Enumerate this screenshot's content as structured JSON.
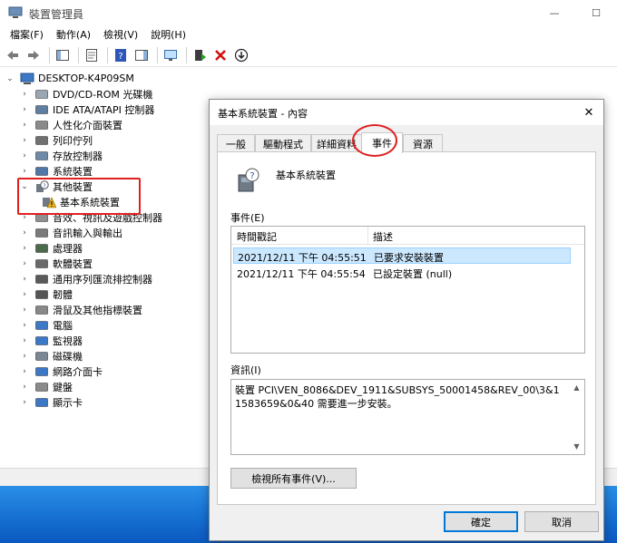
{
  "window": {
    "title": "裝置管理員",
    "minimize_glyph": "—",
    "maximize_glyph": "☐",
    "close_glyph": "✕"
  },
  "menu": [
    "檔案(F)",
    "動作(A)",
    "檢視(V)",
    "說明(H)"
  ],
  "toolbar": {
    "buttons": [
      "back-icon",
      "forward-icon",
      "show-hide-console-tree-icon",
      "properties-icon",
      "help-icon",
      "action-pane-icon",
      "scan-monitor-icon",
      "update-driver-icon",
      "uninstall-icon",
      "disable-icon"
    ]
  },
  "tree": {
    "root": "DESKTOP-K4P09SM",
    "items": [
      {
        "label": "DVD/CD-ROM 光碟機",
        "icon": "dvd-icon"
      },
      {
        "label": "IDE ATA/ATAPI 控制器",
        "icon": "ide-controller-icon"
      },
      {
        "label": "人性化介面裝置",
        "icon": "hid-icon"
      },
      {
        "label": "列印佇列",
        "icon": "printer-icon"
      },
      {
        "label": "存放控制器",
        "icon": "storage-controller-icon"
      },
      {
        "label": "系統裝置",
        "icon": "system-device-icon"
      },
      {
        "label": "其他裝置",
        "icon": "unknown-device-icon",
        "expanded": true
      },
      {
        "label": "基本系統裝置",
        "icon": "warning-device-icon",
        "child": true
      },
      {
        "label": "音效、視訊及遊戲控制器",
        "icon": "audio-icon"
      },
      {
        "label": "音訊輸入與輸出",
        "icon": "audio-io-icon"
      },
      {
        "label": "處理器",
        "icon": "processor-icon"
      },
      {
        "label": "軟體裝置",
        "icon": "software-device-icon"
      },
      {
        "label": "通用序列匯流排控制器",
        "icon": "usb-icon"
      },
      {
        "label": "韌體",
        "icon": "firmware-icon"
      },
      {
        "label": "滑鼠及其他指標裝置",
        "icon": "mouse-icon"
      },
      {
        "label": "電腦",
        "icon": "computer-icon"
      },
      {
        "label": "監視器",
        "icon": "monitor-icon"
      },
      {
        "label": "磁碟機",
        "icon": "disk-drive-icon"
      },
      {
        "label": "網路介面卡",
        "icon": "network-adapter-icon"
      },
      {
        "label": "鍵盤",
        "icon": "keyboard-icon"
      },
      {
        "label": "顯示卡",
        "icon": "display-adapter-icon"
      }
    ]
  },
  "dialog": {
    "title": "基本系統裝置 - 內容",
    "close_glyph": "✕",
    "tabs": [
      "一般",
      "驅動程式",
      "詳細資料",
      "事件",
      "資源"
    ],
    "active_tab": "事件",
    "device_name": "基本系統裝置",
    "events_label": "事件(E)",
    "columns": [
      "時間戳記",
      "描述"
    ],
    "events": [
      {
        "time": "2021/12/11 下午 04:55:51",
        "desc": "已要求安裝裝置",
        "selected": true
      },
      {
        "time": "2021/12/11 下午 04:55:54",
        "desc": "已設定裝置 (null)",
        "selected": false
      }
    ],
    "info_label": "資訊(I)",
    "info_text": "裝置 PCI\\VEN_8086&DEV_1911&SUBSYS_50001458&REV_00\\3&11583659&0&40 需要進一步安裝。",
    "view_all_button": "檢視所有事件(V)...",
    "ok_button": "確定",
    "cancel_button": "取消"
  },
  "colors": {
    "highlight": "#e02020",
    "selection": "#cce8ff",
    "accent": "#0078d7"
  }
}
